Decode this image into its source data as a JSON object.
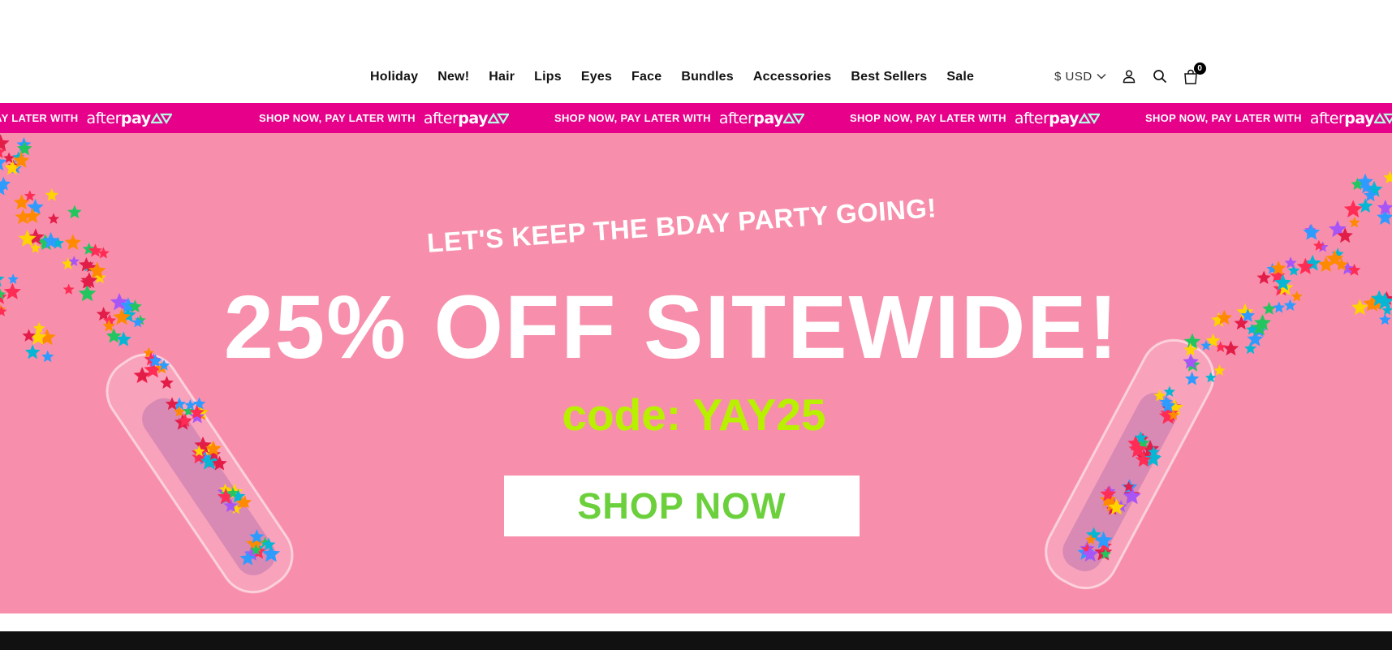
{
  "nav": {
    "items": [
      "Holiday",
      "New!",
      "Hair",
      "Lips",
      "Eyes",
      "Face",
      "Bundles",
      "Accessories",
      "Best Sellers",
      "Sale"
    ]
  },
  "utils": {
    "currency": "$ USD",
    "currency_icon": "chevron-down-icon",
    "account_icon": "user-icon",
    "search_icon": "search-icon",
    "cart_icon": "shopping-bag-icon",
    "cart_count": "0"
  },
  "announcement": {
    "text_first": "OW, PAY LATER WITH",
    "text": "SHOP NOW, PAY LATER WITH",
    "logo_light": "after",
    "logo_bold": "pay",
    "color": "#e6008a"
  },
  "hero": {
    "eyebrow": "LET'S KEEP THE BDAY PARTY GOING!",
    "headline": "25% OFF SITEWIDE!",
    "code": "code: YAY25",
    "cta": "SHOP NOW",
    "background": "#f78fac",
    "code_color": "#b8f000",
    "cta_color": "#6bd03c"
  }
}
